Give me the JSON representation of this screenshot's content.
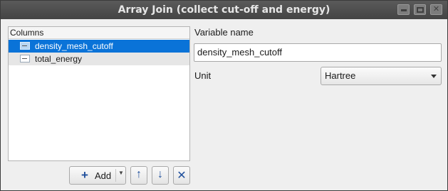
{
  "window": {
    "title": "Array Join (collect cut-off and energy)"
  },
  "list": {
    "header": "Columns",
    "items": [
      {
        "label": "density_mesh_cutoff",
        "selected": true
      },
      {
        "label": "total_energy",
        "selected": false
      }
    ]
  },
  "toolbar": {
    "add_label": "Add",
    "add_icon": "plus-icon",
    "up_icon": "arrow-up-icon",
    "down_icon": "arrow-down-icon",
    "remove_icon": "close-icon"
  },
  "form": {
    "variable_name_label": "Variable name",
    "variable_name_value": "density_mesh_cutoff",
    "unit_label": "Unit",
    "unit_value": "Hartree"
  },
  "colors": {
    "selection": "#0a73d8",
    "titlebar": "#4a4a4a",
    "icon_blue": "#1f4f9c"
  }
}
